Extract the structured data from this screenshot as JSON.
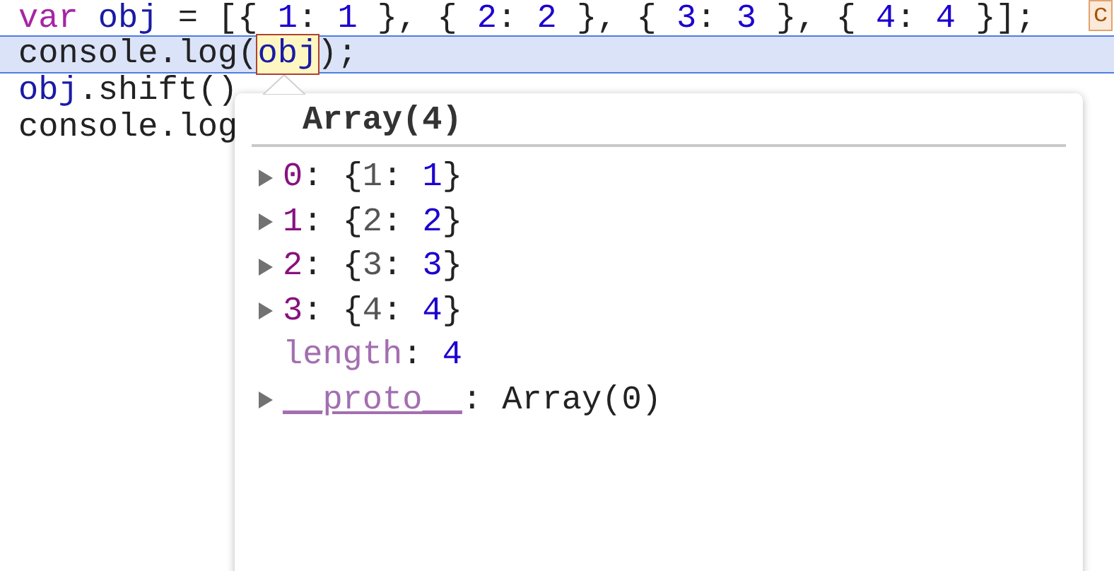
{
  "editor": {
    "lines": [
      {
        "highlighted": false,
        "tokens": [
          {
            "text": "var ",
            "kind": "keyword"
          },
          {
            "text": "obj",
            "kind": "variable"
          },
          {
            "text": " = [{ ",
            "kind": "plain"
          },
          {
            "text": "1",
            "kind": "number"
          },
          {
            "text": ": ",
            "kind": "plain"
          },
          {
            "text": "1",
            "kind": "number"
          },
          {
            "text": " }, { ",
            "kind": "plain"
          },
          {
            "text": "2",
            "kind": "number"
          },
          {
            "text": ": ",
            "kind": "plain"
          },
          {
            "text": "2",
            "kind": "number"
          },
          {
            "text": " }, { ",
            "kind": "plain"
          },
          {
            "text": "3",
            "kind": "number"
          },
          {
            "text": ": ",
            "kind": "plain"
          },
          {
            "text": "3",
            "kind": "number"
          },
          {
            "text": " }, { ",
            "kind": "plain"
          },
          {
            "text": "4",
            "kind": "number"
          },
          {
            "text": ": ",
            "kind": "plain"
          },
          {
            "text": "4",
            "kind": "number"
          },
          {
            "text": " }];",
            "kind": "plain"
          }
        ]
      },
      {
        "highlighted": true,
        "tokens": [
          {
            "text": "console.log(",
            "kind": "plain"
          },
          {
            "text": "obj",
            "kind": "hovered"
          },
          {
            "text": ");",
            "kind": "plain"
          }
        ]
      },
      {
        "highlighted": false,
        "tokens": [
          {
            "text": "obj",
            "kind": "variable"
          },
          {
            "text": ".shift()",
            "kind": "plain"
          }
        ]
      },
      {
        "highlighted": false,
        "tokens": [
          {
            "text": "console.log",
            "kind": "plain"
          }
        ]
      }
    ],
    "badge": "c"
  },
  "popover": {
    "title": "Array(4)",
    "entries": [
      {
        "expandable": true,
        "tokens": [
          {
            "text": "0",
            "kind": "index"
          },
          {
            "text": ": {",
            "kind": "plain"
          },
          {
            "text": "1",
            "kind": "name"
          },
          {
            "text": ": ",
            "kind": "plain"
          },
          {
            "text": "1",
            "kind": "number"
          },
          {
            "text": "}",
            "kind": "plain"
          }
        ]
      },
      {
        "expandable": true,
        "tokens": [
          {
            "text": "1",
            "kind": "index"
          },
          {
            "text": ": {",
            "kind": "plain"
          },
          {
            "text": "2",
            "kind": "name"
          },
          {
            "text": ": ",
            "kind": "plain"
          },
          {
            "text": "2",
            "kind": "number"
          },
          {
            "text": "}",
            "kind": "plain"
          }
        ]
      },
      {
        "expandable": true,
        "tokens": [
          {
            "text": "2",
            "kind": "index"
          },
          {
            "text": ": {",
            "kind": "plain"
          },
          {
            "text": "3",
            "kind": "name"
          },
          {
            "text": ": ",
            "kind": "plain"
          },
          {
            "text": "3",
            "kind": "number"
          },
          {
            "text": "}",
            "kind": "plain"
          }
        ]
      },
      {
        "expandable": true,
        "tokens": [
          {
            "text": "3",
            "kind": "index"
          },
          {
            "text": ": {",
            "kind": "plain"
          },
          {
            "text": "4",
            "kind": "name"
          },
          {
            "text": ": ",
            "kind": "plain"
          },
          {
            "text": "4",
            "kind": "number"
          },
          {
            "text": "}",
            "kind": "plain"
          }
        ]
      },
      {
        "expandable": false,
        "tokens": [
          {
            "text": "length",
            "kind": "internal"
          },
          {
            "text": ": ",
            "kind": "plain"
          },
          {
            "text": "4",
            "kind": "number"
          }
        ]
      },
      {
        "expandable": true,
        "tokens": [
          {
            "text": "__proto__",
            "kind": "internal-underlined"
          },
          {
            "text": ": Array(0)",
            "kind": "plain"
          }
        ]
      }
    ]
  }
}
